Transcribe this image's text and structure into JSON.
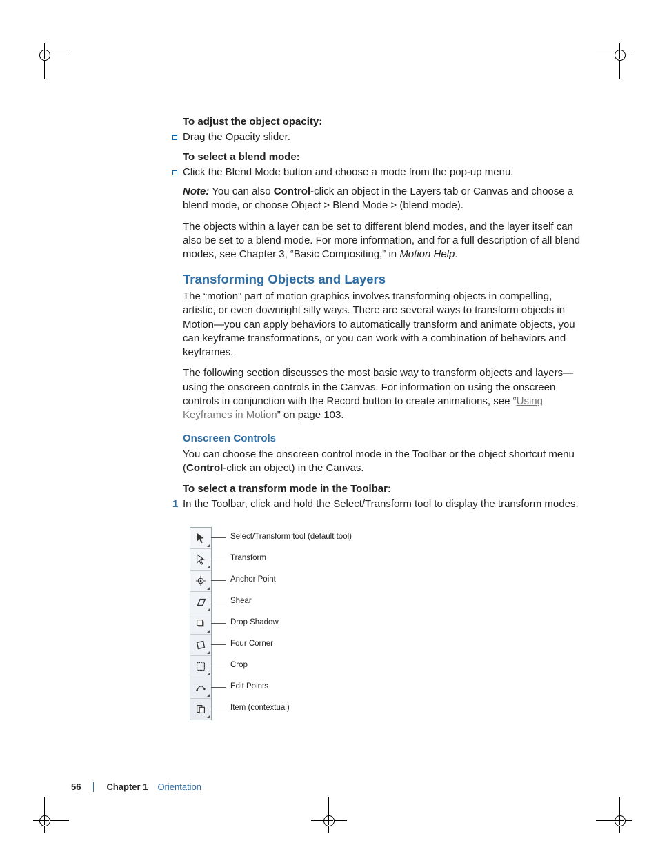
{
  "p1_heading": "To adjust the object opacity:",
  "p1_bullet": "Drag the Opacity slider.",
  "p2_heading": "To select a blend mode:",
  "p2_bullet": "Click the Blend Mode button and choose a mode from the pop-up menu.",
  "note_label": "Note:",
  "note_text1": "  You can also ",
  "note_bold": "Control",
  "note_text2": "-click an object in the Layers tab or Canvas and choose a blend mode, or choose Object > Blend Mode > (blend mode).",
  "para_layers": "The objects within a layer can be set to different blend modes, and the layer itself can also be set to a blend mode. For more information, and for a full description of all blend modes, see Chapter 3, “Basic Compositing,” in ",
  "para_layers_ital": "Motion Help",
  "para_layers_end": ".",
  "h_transform": "Transforming Objects and Layers",
  "para_t1": "The “motion” part of motion graphics involves transforming objects in compelling, artistic, or even downright silly ways. There are several ways to transform objects in Motion—you can apply behaviors to automatically transform and animate objects, you can keyframe transformations, or you can work with a combination of behaviors and keyframes.",
  "para_t2a": "The following section discusses the most basic way to transform objects and layers—using the onscreen controls in the Canvas. For information on using the onscreen controls in conjunction with the Record button to create animations, see “",
  "para_t2_link": "Using Keyframes in Motion",
  "para_t2b": "” on page 103.",
  "h_onscreen": "Onscreen Controls",
  "para_osc1": "You can choose the onscreen control mode in the Toolbar or the object shortcut menu (",
  "para_osc_bold": "Control",
  "para_osc2": "-click an object) in the Canvas.",
  "step_h": "To select a transform mode in the Toolbar:",
  "step_num": "1",
  "step_text": "In the Toolbar, click and hold the Select/Transform tool to display the transform modes.",
  "tools": {
    "t0": "Select/Transform tool (default tool)",
    "t1": "Transform",
    "t2": "Anchor Point",
    "t3": "Shear",
    "t4": "Drop Shadow",
    "t5": "Four Corner",
    "t6": "Crop",
    "t7": "Edit Points",
    "t8": "Item (contextual)"
  },
  "footer": {
    "page": "56",
    "chapter": "Chapter 1",
    "name": "Orientation"
  }
}
